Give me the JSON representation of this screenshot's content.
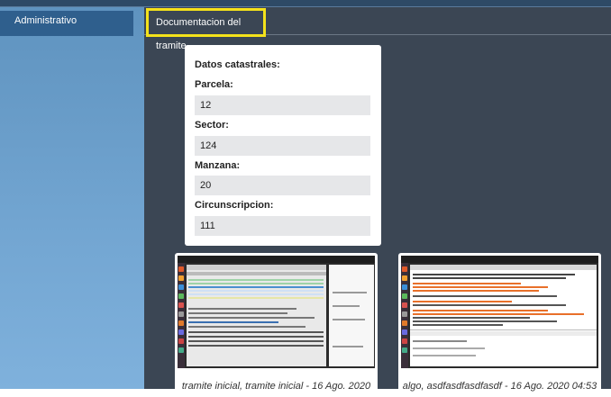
{
  "sidebar": {
    "items": [
      {
        "label": "Administrativo"
      }
    ]
  },
  "tabs": [
    {
      "label": "Documentacion del tramite"
    }
  ],
  "catastro": {
    "heading": "Datos catastrales:",
    "fields": [
      {
        "label": "Parcela:",
        "value": "12"
      },
      {
        "label": "Sector:",
        "value": "124"
      },
      {
        "label": "Manzana:",
        "value": "20"
      },
      {
        "label": "Circunscripcion:",
        "value": "111"
      }
    ]
  },
  "documents": [
    {
      "caption": "tramite inicial, tramite inicial - 16 Ago. 2020"
    },
    {
      "caption": "algo, asdfasdfasdfasdf - 16 Ago. 2020 04:53"
    }
  ],
  "colors": {
    "highlight": "#f4e21b",
    "main_bg": "#3b4654",
    "sidebar_active": "#2f5f8d"
  }
}
